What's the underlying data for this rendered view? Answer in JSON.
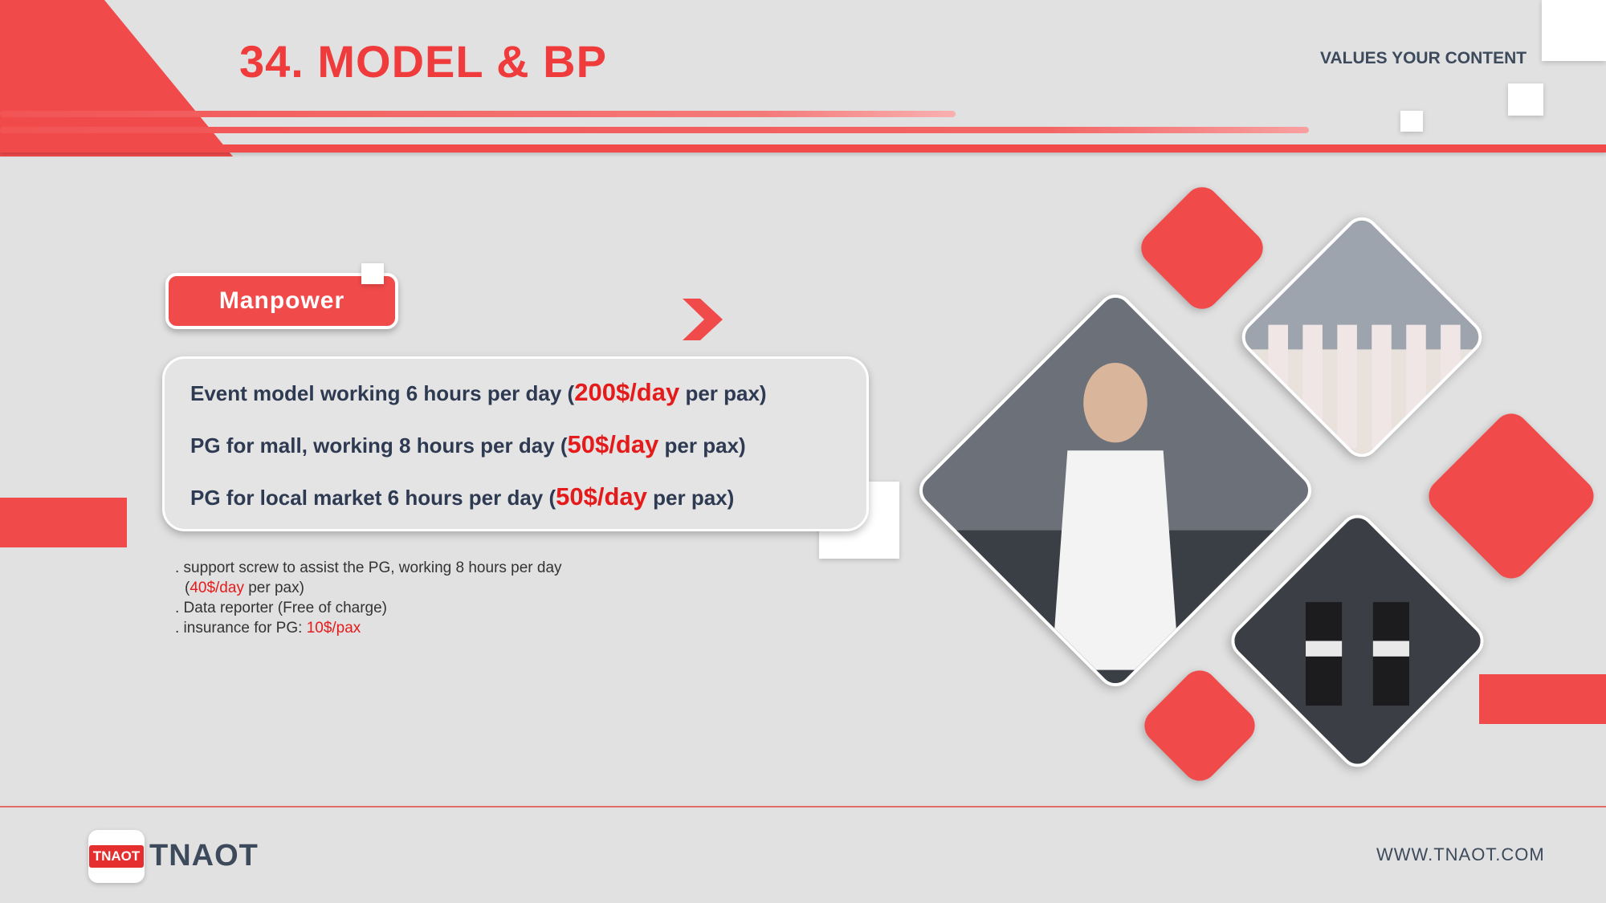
{
  "header": {
    "title": "34. MODEL & BP",
    "tagline": "VALUES YOUR CONTENT"
  },
  "manpower": {
    "label": "Manpower"
  },
  "card": {
    "lines": [
      {
        "before": "Event model working 6 hours per day (",
        "price": "200$/day",
        "after": " per pax)"
      },
      {
        "before": "PG for mall, working 8 hours per day (",
        "price": "50$/day",
        "after": " per pax)"
      },
      {
        "before": "PG for local market 6 hours per day (",
        "price": "50$/day",
        "after": " per pax)"
      }
    ]
  },
  "notes": {
    "line1": ". support screw to assist the PG, working 8 hours per day",
    "line2_open": "(",
    "line2_price": "40$/day",
    "line2_after": " per pax)",
    "line3": ". Data reporter (Free of charge)",
    "line4_before": ". insurance for PG: ",
    "line4_price": "10$/pax"
  },
  "footer": {
    "logo_badge": "TNAOT",
    "logo_text": "TNAOT",
    "website": "WWW.TNAOT.COM"
  },
  "colors": {
    "accent": "#f14a4a",
    "price": "#e51b1b",
    "text_dark": "#2e3a52",
    "background": "#e1e1e1"
  }
}
